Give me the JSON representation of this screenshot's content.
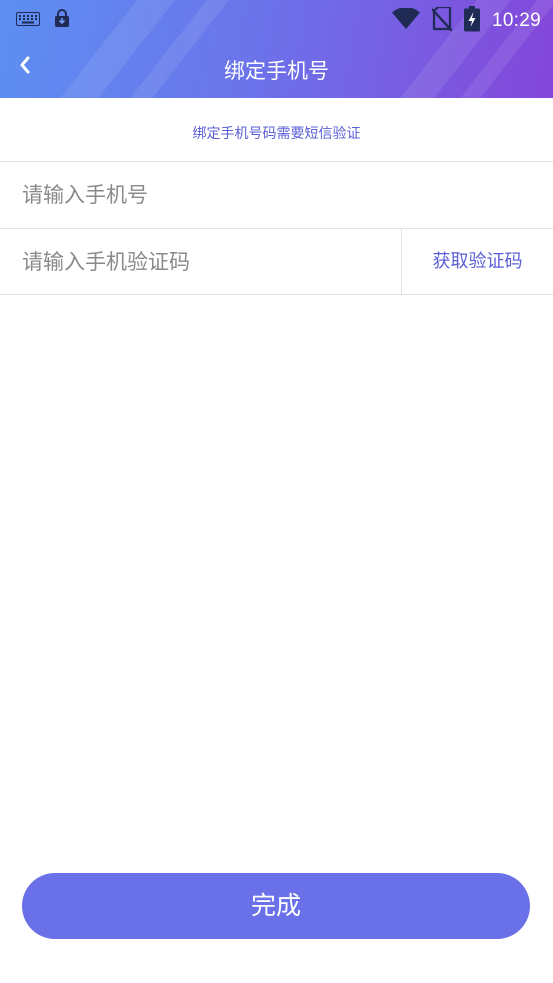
{
  "status_bar": {
    "time": "10:29",
    "icons": [
      "keyboard-icon",
      "lock-download-icon",
      "wifi-icon",
      "no-sim-icon",
      "battery-charging-icon"
    ]
  },
  "header": {
    "title": "绑定手机号",
    "back_icon": "chevron-left-icon"
  },
  "form": {
    "hint": "绑定手机号码需要短信验证",
    "phone_placeholder": "请输入手机号",
    "code_placeholder": "请输入手机验证码",
    "get_code_label": "获取验证码"
  },
  "actions": {
    "done_label": "完成"
  },
  "colors": {
    "accent": "#5a5fd6",
    "button": "#6a70e8",
    "header_start": "#5d8ff2",
    "header_end": "#8446d9"
  }
}
